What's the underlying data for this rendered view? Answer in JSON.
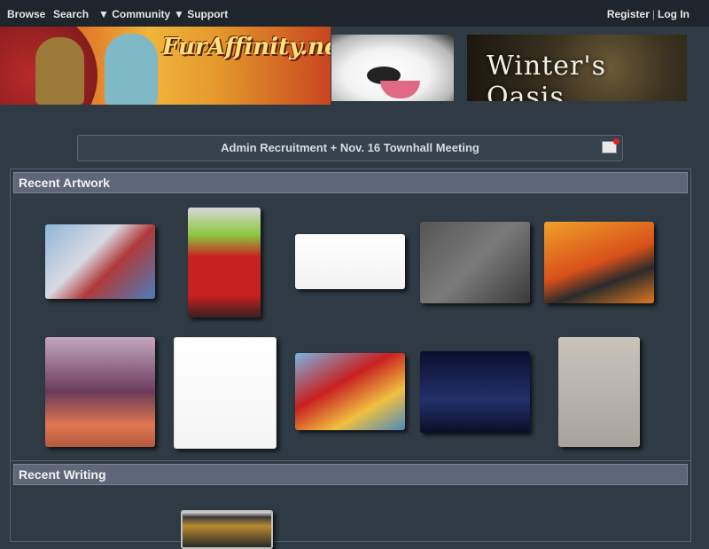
{
  "nav": {
    "browse": "Browse",
    "search": "Search",
    "community": "▼ Community",
    "support": "▼ Support",
    "register": "Register",
    "divider": "|",
    "login": "Log In"
  },
  "banner": {
    "logo_text": "FurAffinity.net",
    "ad_text": "Winter's Oasis"
  },
  "notice": {
    "text": "Admin Recruitment + Nov. 16 Townhall Meeting"
  },
  "sections": {
    "artwork_title": "Recent Artwork",
    "writing_title": "Recent Writing"
  },
  "thumbs": [
    {
      "name": "artwork-thumb-1",
      "bg": "linear-gradient(135deg,#8fb7d8,#d9d9e3 40%,#b03a3a 60%,#4a7db8)"
    },
    {
      "name": "artwork-thumb-2",
      "bg": "linear-gradient(180deg,#d8d8d8 0%,#8cc63f 25%,#c72020 45%,#c72020 80%,#3a2020 100%)"
    },
    {
      "name": "artwork-thumb-3",
      "bg": "linear-gradient(180deg,#ffffff,#f2f2f2)"
    },
    {
      "name": "artwork-thumb-4",
      "bg": "linear-gradient(135deg,#555,#7a7a7a 50%,#3a3a3a)"
    },
    {
      "name": "artwork-thumb-5",
      "bg": "linear-gradient(160deg,#f0a12a,#d8501a 50%,#2b2b2b 70%,#e07820)"
    },
    {
      "name": "artwork-thumb-6",
      "bg": "linear-gradient(180deg,#c4a8c0,#6a3a5a 50%,#e07850 80%,#b35a40)"
    },
    {
      "name": "artwork-thumb-7",
      "bg": "linear-gradient(180deg,#ffffff,#f4f4f4)"
    },
    {
      "name": "artwork-thumb-8",
      "bg": "linear-gradient(150deg,#7ab4e0,#c82020 40%,#f0c040 70%,#4a8ac0)"
    },
    {
      "name": "artwork-thumb-9",
      "bg": "linear-gradient(180deg,#0a0f30,#22306a 60%,#0a0f28)"
    },
    {
      "name": "artwork-thumb-10",
      "bg": "linear-gradient(180deg,#c8c4bc,#a8a49c)"
    },
    {
      "name": "writing-thumb-1",
      "bg": "linear-gradient(180deg,#e0e0e0,#3a3a3a 15%,#b88a30 40%,#2a2a2a)"
    }
  ]
}
